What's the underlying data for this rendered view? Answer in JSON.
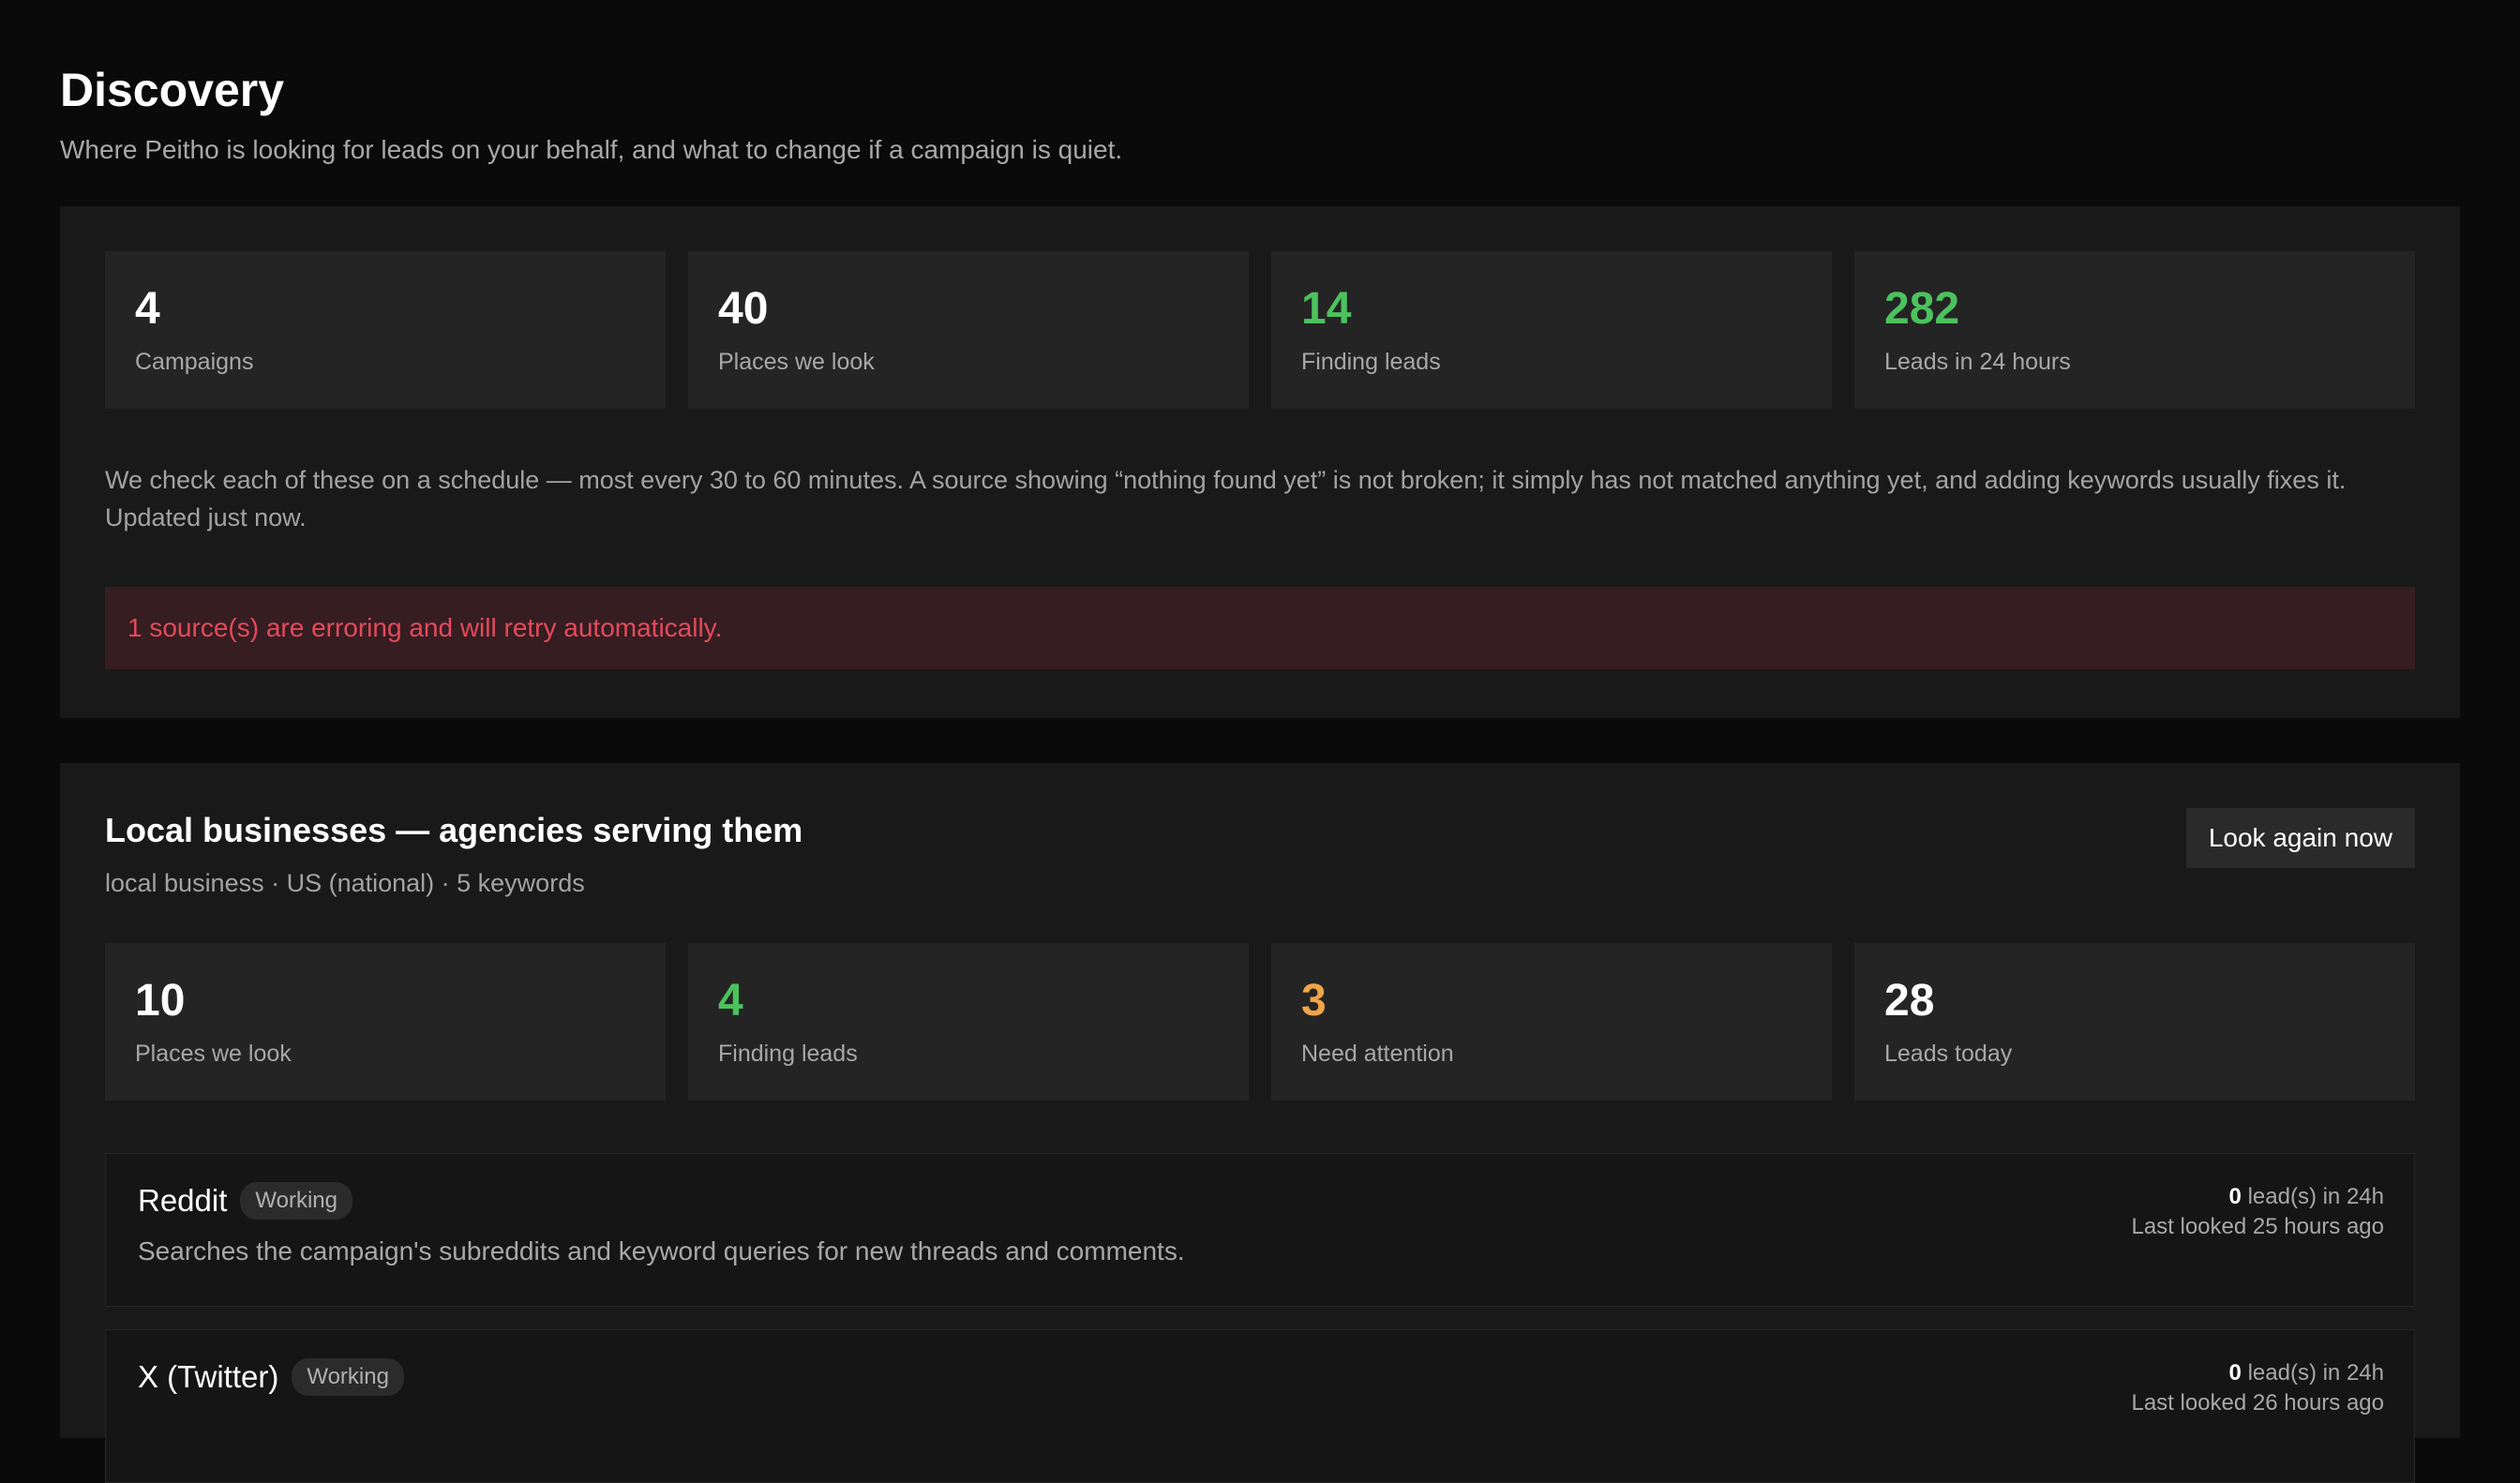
{
  "header": {
    "title": "Discovery",
    "subtitle": "Where Peitho is looking for leads on your behalf, and what to change if a campaign is quiet."
  },
  "summary": {
    "stats": [
      {
        "value": "4",
        "label": "Campaigns",
        "color": "#ffffff"
      },
      {
        "value": "40",
        "label": "Places we look",
        "color": "#ffffff"
      },
      {
        "value": "14",
        "label": "Finding leads",
        "color": "#4cc25e"
      },
      {
        "value": "282",
        "label": "Leads in 24 hours",
        "color": "#4cc25e"
      }
    ],
    "explanation": "We check each of these on a schedule — most every 30 to 60 minutes. A source showing “nothing found yet” is not broken; it simply has not matched anything yet, and adding keywords usually fixes it. Updated just now.",
    "alert": "1 source(s) are erroring and will retry automatically.",
    "alert_color": "#e44a5c"
  },
  "campaign": {
    "title": "Local businesses — agencies serving them",
    "meta": "local business · US (national) · 5 keywords",
    "button_label": "Look again now",
    "stats": [
      {
        "value": "10",
        "label": "Places we look",
        "color": "#ffffff"
      },
      {
        "value": "4",
        "label": "Finding leads",
        "color": "#4cc25e"
      },
      {
        "value": "3",
        "label": "Need attention",
        "color": "#f0a548"
      },
      {
        "value": "28",
        "label": "Leads today",
        "color": "#ffffff"
      }
    ],
    "sources": [
      {
        "name": "Reddit",
        "status": "Working",
        "description": "Searches the campaign's subreddits and keyword queries for new threads and comments.",
        "lead_count": "0",
        "lead_suffix": " lead(s) in 24h",
        "last_looked": "Last looked 25 hours ago"
      },
      {
        "name": "X (Twitter)",
        "status": "Working",
        "description": "",
        "lead_count": "0",
        "lead_suffix": " lead(s) in 24h",
        "last_looked": "Last looked 26 hours ago"
      }
    ]
  }
}
